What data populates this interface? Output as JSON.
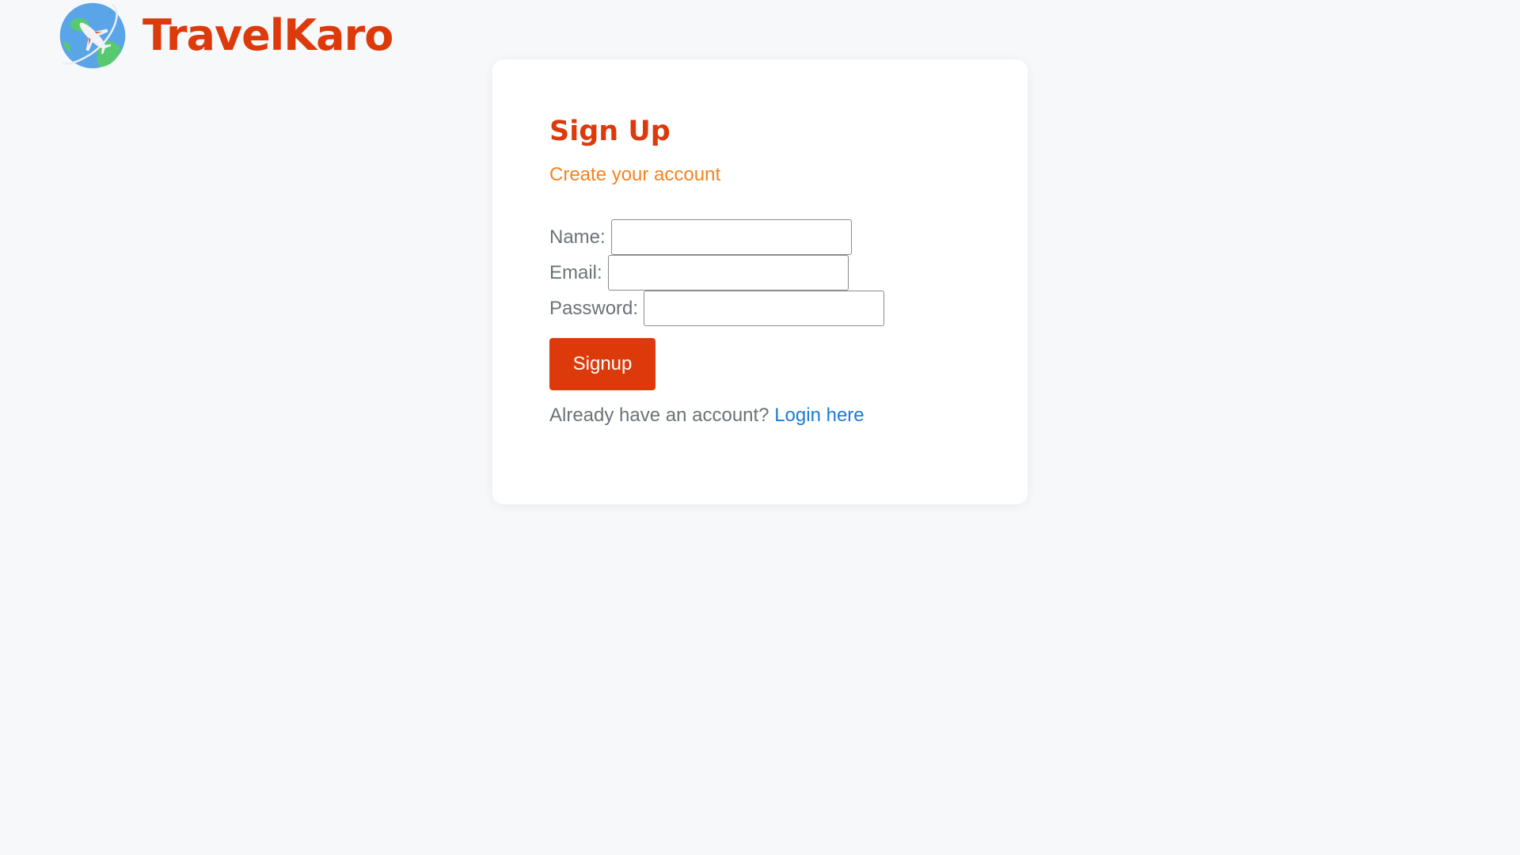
{
  "brand": {
    "name": "TravelKaro",
    "logo_icon": "globe-airplane-icon",
    "color": "#dd3a0b"
  },
  "signup": {
    "title": "Sign Up",
    "subtitle": "Create your account",
    "fields": {
      "name_label": "Name:",
      "name_value": "",
      "email_label": "Email:",
      "email_value": "",
      "password_label": "Password:",
      "password_value": ""
    },
    "submit_label": "Signup",
    "login_prompt": "Already have an account?",
    "login_link": "Login here"
  },
  "colors": {
    "accent": "#dd3a0b",
    "subtitle": "#f5821f",
    "link": "#1b7bd8",
    "background": "#f7f8fa"
  }
}
